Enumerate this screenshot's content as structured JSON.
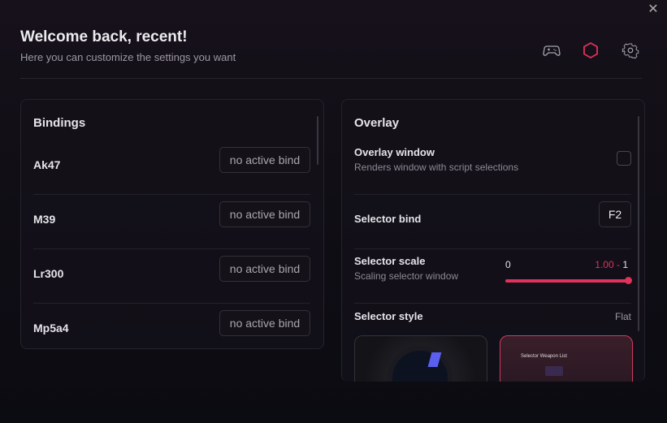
{
  "header": {
    "title": "Welcome back, recent!",
    "subtitle": "Here you can customize the settings you want",
    "icons": [
      "gamepad-icon",
      "hexagon-icon",
      "gear-icon"
    ],
    "active_icon": "hexagon-icon",
    "accent": "#e0325a"
  },
  "bindings": {
    "title": "Bindings",
    "items": [
      {
        "name": "Ak47",
        "bind": "no active bind"
      },
      {
        "name": "M39",
        "bind": "no active bind"
      },
      {
        "name": "Lr300",
        "bind": "no active bind"
      },
      {
        "name": "Mp5a4",
        "bind": "no active bind"
      }
    ]
  },
  "overlay": {
    "title": "Overlay",
    "window": {
      "label": "Overlay window",
      "desc": "Renders window with script selections",
      "checked": false
    },
    "selector_bind": {
      "label": "Selector bind",
      "value": "F2"
    },
    "selector_scale": {
      "label": "Selector scale",
      "desc": "Scaling selector window",
      "min": "0",
      "value": "1.00",
      "sep": " - ",
      "max": "1",
      "fraction": 1.0
    },
    "selector_style": {
      "label": "Selector style",
      "value": "Flat",
      "preview_title": "Selector Weapon List"
    }
  }
}
